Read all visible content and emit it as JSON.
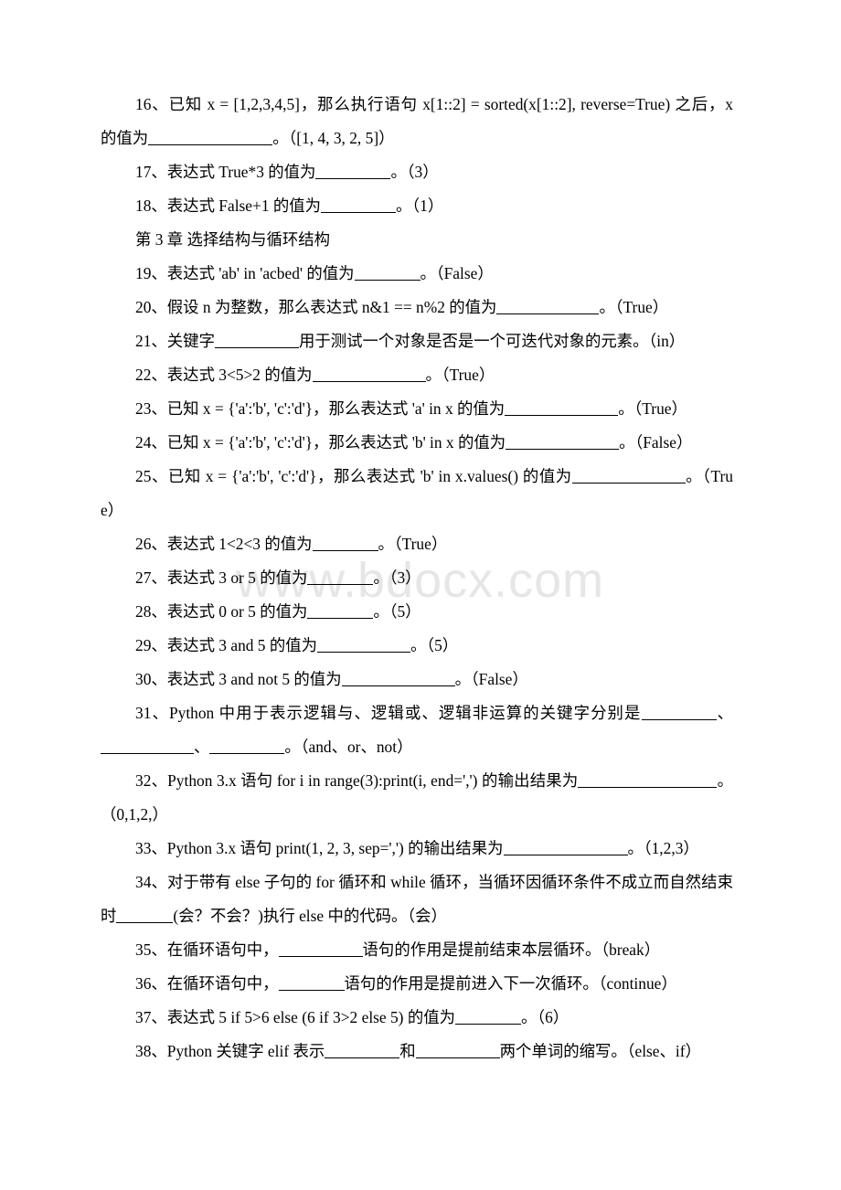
{
  "document": {
    "type": "exam-fill-in-the-blank-worksheet",
    "language": "zh-CN",
    "watermark": "www.bdocx.com",
    "chapter_heading": "第 3 章 选择结构与循环结构",
    "questions": [
      {
        "number": "16",
        "pre": "16、已知 x = [1,2,3,4,5]，那么执行语句 x[1::2] = sorted(x[1::2], reverse=True) 之后，x 的值为",
        "blank_widths": [
          "w14"
        ],
        "post": "。（[1, 4, 3, 2, 5]）",
        "answer": "[1, 4, 3, 2, 5]"
      },
      {
        "number": "17",
        "pre": "17、表达式 True*3 的值为",
        "blank_widths": [
          "w9"
        ],
        "post": "。（3）",
        "answer": "3"
      },
      {
        "number": "18",
        "pre": "18、表达式 False+1 的值为",
        "blank_widths": [
          "w9"
        ],
        "post": "。（1）",
        "answer": "1"
      },
      {
        "number": "19",
        "pre": "19、表达式 'ab' in 'acbed' 的值为",
        "blank_widths": [
          "w8"
        ],
        "post": "。（False）",
        "answer": "False"
      },
      {
        "number": "20",
        "pre": "20、假设 n 为整数，那么表达式 n&1 == n%2 的值为",
        "blank_widths": [
          "w12"
        ],
        "post": "。（True）",
        "answer": "True"
      },
      {
        "number": "21",
        "pre": "21、关键字",
        "blank_widths": [
          "w10"
        ],
        "post": "用于测试一个对象是否是一个可迭代对象的元素。（in）",
        "answer": "in"
      },
      {
        "number": "22",
        "pre": "22、表达式 3<5>2 的值为",
        "blank_widths": [
          "w13"
        ],
        "post": "。（True）",
        "answer": "True"
      },
      {
        "number": "23",
        "pre": "23、已知 x = {'a':'b', 'c':'d'}，那么表达式 'a' in x 的值为",
        "blank_widths": [
          "w13"
        ],
        "post": "。（True）",
        "answer": "True"
      },
      {
        "number": "24",
        "pre": "24、已知 x = {'a':'b', 'c':'d'}，那么表达式 'b' in x 的值为",
        "blank_widths": [
          "w13"
        ],
        "post": "。（False）",
        "answer": "False"
      },
      {
        "number": "25",
        "pre": "25、已知 x = {'a':'b', 'c':'d'}，那么表达式 'b' in x.values() 的值为",
        "blank_widths": [
          "w13"
        ],
        "post": "。（True）",
        "answer": "True"
      },
      {
        "number": "26",
        "pre": "26、表达式 1<2<3 的值为",
        "blank_widths": [
          "w8"
        ],
        "post": "。（True）",
        "answer": "True"
      },
      {
        "number": "27",
        "pre": "27、表达式 3 or 5 的值为",
        "blank_widths": [
          "w8"
        ],
        "post": "。（3）",
        "answer": "3"
      },
      {
        "number": "28",
        "pre": "28、表达式 0 or 5 的值为",
        "blank_widths": [
          "w8"
        ],
        "post": "。（5）",
        "answer": "5"
      },
      {
        "number": "29",
        "pre": "29、表达式 3 and 5 的值为",
        "blank_widths": [
          "w11"
        ],
        "post": "。（5）",
        "answer": "5"
      },
      {
        "number": "30",
        "pre": "30、表达式 3 and not 5 的值为",
        "blank_widths": [
          "w13"
        ],
        "post": "。（False）",
        "answer": "False"
      },
      {
        "number": "31",
        "pre": "31、Python 中用于表示逻辑与、逻辑或、逻辑非运算的关键字分别是",
        "mid1": "、",
        "mid2": "、",
        "blank_widths": [
          "w9",
          "w11",
          "w9"
        ],
        "post": "。（and、or、not）",
        "answer": "and、or、not"
      },
      {
        "number": "32",
        "pre": "32、Python 3.x 语句 for i in range(3):print(i, end=',') 的输出结果为",
        "blank_widths": [
          "w16"
        ],
        "post": "。（0,1,2,）",
        "answer": "0,1,2,"
      },
      {
        "number": "33",
        "pre": "33、Python 3.x 语句 print(1, 2, 3, sep=',') 的输出结果为",
        "blank_widths": [
          "w14"
        ],
        "post": "。（1,2,3）",
        "answer": "1,2,3"
      },
      {
        "number": "34",
        "pre": "34、对于带有 else 子句的 for 循环和 while 循环，当循环因循环条件不成立而自然结束时",
        "blank_widths": [
          "w7"
        ],
        "post": "(会？不会？)执行 else 中的代码。（会）",
        "answer": "会"
      },
      {
        "number": "35",
        "pre": "35、在循环语句中，",
        "blank_widths": [
          "w10"
        ],
        "post": "语句的作用是提前结束本层循环。（break）",
        "answer": "break"
      },
      {
        "number": "36",
        "pre": "36、在循环语句中，",
        "blank_widths": [
          "w8"
        ],
        "post": "语句的作用是提前进入下一次循环。（continue）",
        "answer": "continue"
      },
      {
        "number": "37",
        "pre": "37、表达式 5 if 5>6 else (6 if 3>2 else 5) 的值为",
        "blank_widths": [
          "w8"
        ],
        "post": "。（6）",
        "answer": "6"
      },
      {
        "number": "38",
        "pre": "38、Python 关键字 elif 表示",
        "mid1": "和",
        "blank_widths": [
          "w9",
          "w10"
        ],
        "post": "两个单词的缩写。（else、if）",
        "answer": "else、if"
      }
    ]
  }
}
